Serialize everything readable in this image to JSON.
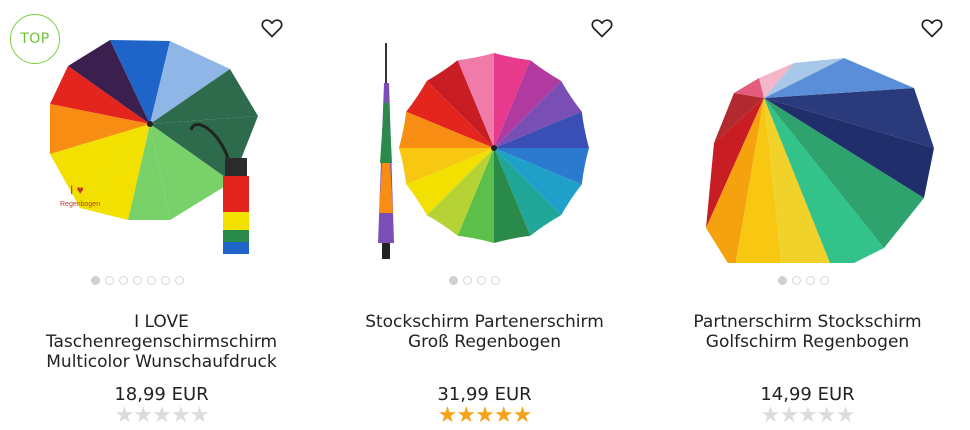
{
  "badge": "TOP",
  "colors": {
    "accent_green": "#6cc235",
    "star_on": "#f7a21b",
    "star_off": "#dcdcdc"
  },
  "products": [
    {
      "title_lines": [
        "I LOVE",
        "Taschenregenschirmschirm",
        "Multicolor Wunschaufdruck"
      ],
      "price": "18,99 EUR",
      "rating": 0,
      "images": 7,
      "active": 0,
      "print": "Regenbogen"
    },
    {
      "title_lines": [
        "Stockschirm Partenerschirm",
        "Groß Regenbogen"
      ],
      "price": "31,99 EUR",
      "rating": 5,
      "images": 4,
      "active": 0
    },
    {
      "title_lines": [
        "Partnerschirm Stockschirm",
        "Golfschirm Regenbogen"
      ],
      "price": "14,99 EUR",
      "rating": 0,
      "images": 4,
      "active": 0
    }
  ]
}
